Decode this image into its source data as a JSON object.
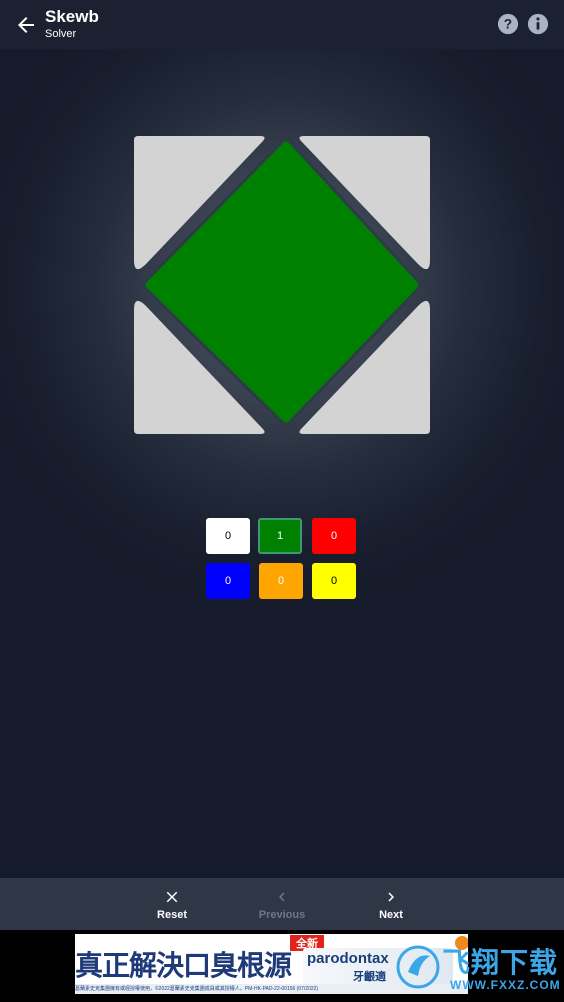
{
  "app": {
    "title": "Skewb",
    "subtitle": "Solver"
  },
  "header": {
    "help_icon": "help-circle-icon",
    "info_icon": "info-circle-icon",
    "back_icon": "arrow-left-icon"
  },
  "cube_face": {
    "center_color": "#008000",
    "corner_color": "#d3d3d3",
    "corners": [
      "top-left",
      "top-right",
      "bottom-left",
      "bottom-right"
    ]
  },
  "color_counts": [
    {
      "color": "#ffffff",
      "count": "0",
      "text_color": "#000000",
      "selected": false
    },
    {
      "color": "#008000",
      "count": "1",
      "text_color": "#ffffff",
      "selected": true
    },
    {
      "color": "#ff0000",
      "count": "0",
      "text_color": "#ffffff",
      "selected": false
    },
    {
      "color": "#0000ff",
      "count": "0",
      "text_color": "#ffffff",
      "selected": false
    },
    {
      "color": "#ffa500",
      "count": "0",
      "text_color": "#ffffff",
      "selected": false
    },
    {
      "color": "#ffff00",
      "count": "0",
      "text_color": "#000000",
      "selected": false
    }
  ],
  "bottom_nav": {
    "reset": {
      "label": "Reset",
      "icon": "close-icon",
      "enabled": true
    },
    "previous": {
      "label": "Previous",
      "icon": "chevron-left-icon",
      "enabled": false
    },
    "next": {
      "label": "Next",
      "icon": "chevron-right-icon",
      "enabled": true
    }
  },
  "ad": {
    "headline": "真正解決口臭根源",
    "tag": "全新",
    "brand": "parodontax",
    "sub": "牙齦適",
    "fine_print": "葛蘭素史克集團擁有或經授權使用，©2022葛蘭素史克集團成員或其授權人。PM-HK-PAD-22-00156 (07/2022)"
  },
  "watermark": {
    "text": "飞翔下载",
    "url": "WWW.FXXZ.COM"
  }
}
